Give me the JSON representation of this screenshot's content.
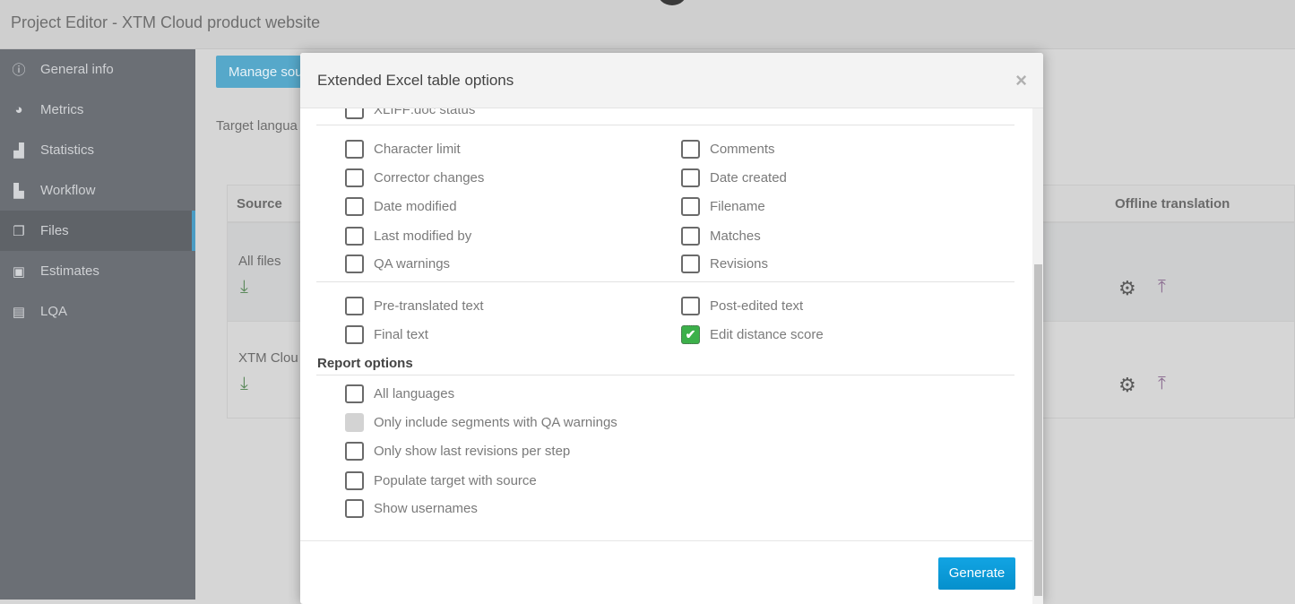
{
  "header": {
    "title": "Project Editor  -  XTM Cloud  product website"
  },
  "sidebar": {
    "items": [
      {
        "label": "General info",
        "icon": "info-icon"
      },
      {
        "label": "Metrics",
        "icon": "pie-chart-icon"
      },
      {
        "label": "Statistics",
        "icon": "bar-chart-icon"
      },
      {
        "label": "Workflow",
        "icon": "workflow-icon"
      },
      {
        "label": "Files",
        "icon": "files-icon",
        "active": true
      },
      {
        "label": "Estimates",
        "icon": "money-icon"
      },
      {
        "label": "LQA",
        "icon": "document-icon"
      }
    ]
  },
  "main": {
    "manage_button": "Manage sou",
    "target_label": "Target langua",
    "table": {
      "headers": [
        "Source",
        "Offline translation"
      ],
      "rows": [
        {
          "name": "All files"
        },
        {
          "name": "XTM Clou"
        }
      ]
    }
  },
  "modal": {
    "title": "Extended Excel table options",
    "close": "×",
    "cut_item": "XLIFF:doc status",
    "group1": [
      [
        "Character limit",
        "Comments"
      ],
      [
        "Corrector changes",
        "Date created"
      ],
      [
        "Date modified",
        "Filename"
      ],
      [
        "Last modified by",
        "Matches"
      ],
      [
        "QA warnings",
        "Revisions"
      ]
    ],
    "group2": [
      [
        "Pre-translated text",
        "Post-edited text"
      ],
      [
        "Final text",
        "Edit distance score"
      ]
    ],
    "checked": [
      "Edit distance score"
    ],
    "report_title": "Report options",
    "report": [
      "All languages",
      "Only include segments with QA warnings",
      "Only show last revisions per step",
      "Populate target with source",
      "Show usernames"
    ],
    "disabled": [
      "Only include segments with QA warnings"
    ],
    "generate": "Generate",
    "colors": {
      "accent": "#0a9ad8",
      "checked": "#3cb04a"
    }
  }
}
